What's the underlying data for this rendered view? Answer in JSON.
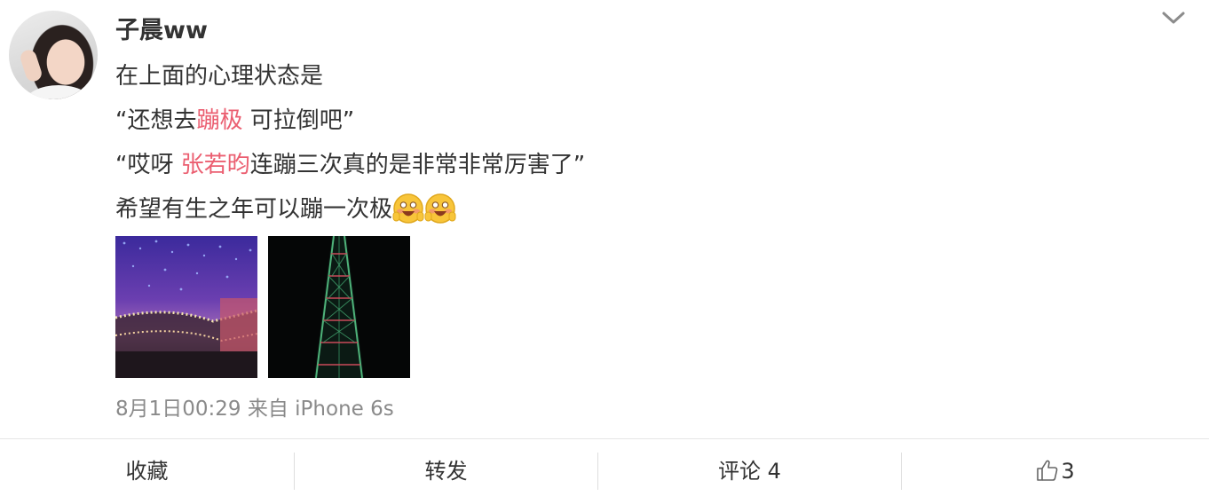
{
  "post": {
    "username": "子晨ww",
    "lines": [
      {
        "text": "在上面的心理状态是"
      },
      {
        "pre": "“还想去",
        "highlight": "蹦极",
        "post": " 可拉倒吧”"
      },
      {
        "pre": "“哎呀 ",
        "highlight": "张若昀",
        "post": "连蹦三次真的是非常非常厉害了”"
      },
      {
        "text": "希望有生之年可以蹦一次极"
      }
    ],
    "emoji_icons": [
      "shy-grin-emoji-icon",
      "shy-grin-emoji-icon"
    ],
    "images": [
      {
        "name": "night-lights-photo"
      },
      {
        "name": "night-tower-photo"
      }
    ],
    "meta": "8月1日00:29 来自 iPhone 6s"
  },
  "actions": {
    "favorite": "收藏",
    "repost": "转发",
    "comment": "评论 4",
    "like_count": "3"
  },
  "colors": {
    "highlight": "#eb5f71",
    "meta_text": "#8a8a8a",
    "divider": "#e6e6e6"
  }
}
